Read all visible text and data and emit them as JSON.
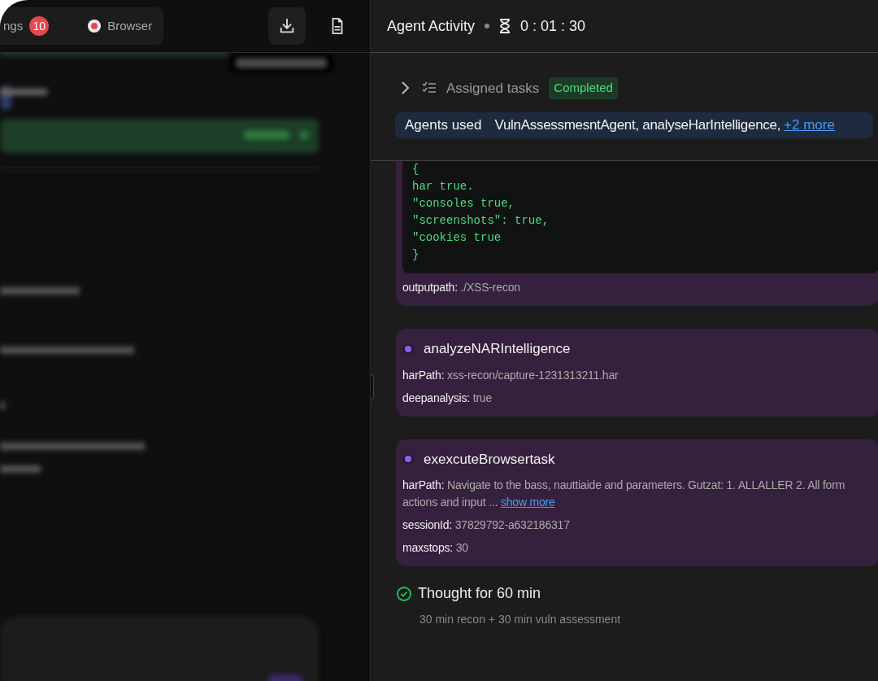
{
  "left_panel": {
    "tabs": [
      {
        "label": "ngs",
        "badge": "10",
        "kind": "count"
      },
      {
        "label": "Browser",
        "kind": "record"
      }
    ],
    "actions": [
      {
        "kind": "download"
      },
      {
        "kind": "document"
      }
    ]
  },
  "activity": {
    "title": "Agent Activity",
    "timer": "0 : 01 : 30",
    "assigned_tasks": {
      "label": "Assigned tasks",
      "status": "Completed",
      "expanded": false
    },
    "agents_used": {
      "label": "Agents used",
      "agents": "VulnAssessmesntAgent, analyseHarIntelligence,",
      "more": "+2 more"
    },
    "tasks": [
      {
        "code": [
          "{",
          "har true.",
          "\"consoles true,",
          "\"screenshots\": true,",
          "\"cookies true",
          "}"
        ],
        "params": [
          {
            "key": "outputpath:",
            "value": "./XSS-recon"
          }
        ]
      },
      {
        "name": "analyzeNARIntelligence",
        "params": [
          {
            "key": "harPath:",
            "value": "xss-recon/capture-1231313211.har"
          },
          {
            "key": "deepanalysis:",
            "value": "true"
          }
        ]
      },
      {
        "name": "exexcuteBrowsertask",
        "params": [
          {
            "key": "harPath:",
            "value": "Navigate to the bass, nauttiaide and parameters. Gutzat: 1. ALLALLER 2. All form actions and input ...",
            "link": "show more"
          },
          {
            "key": "sessionId:",
            "value": "37829792-a632186317"
          },
          {
            "key": "maxstops:",
            "value": "30"
          }
        ]
      }
    ],
    "thought": {
      "title": "Thought for 60 min",
      "detail": "30 min recon + 30 min vuln assessment"
    }
  }
}
